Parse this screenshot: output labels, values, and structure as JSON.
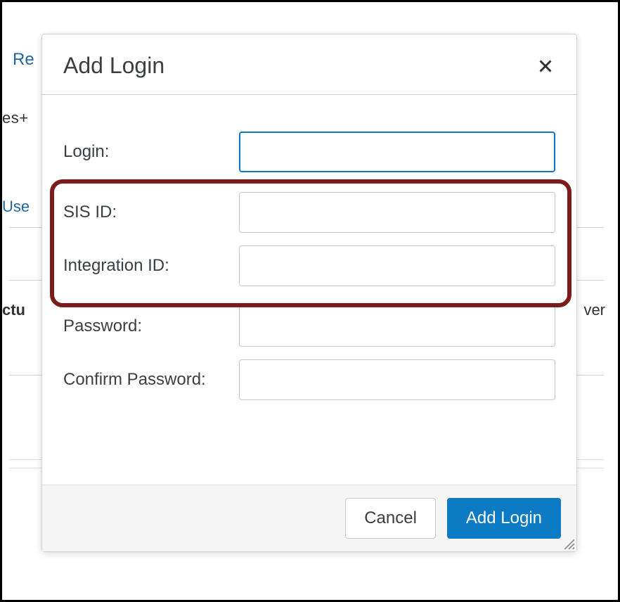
{
  "background": {
    "topLink": "Re",
    "secondLine": "es+",
    "userLink": "Use",
    "leftBold": "ctu",
    "rightText": "ver"
  },
  "modal": {
    "title": "Add Login",
    "fields": {
      "login": {
        "label": "Login:",
        "value": ""
      },
      "sisId": {
        "label": "SIS ID:",
        "value": ""
      },
      "integrationId": {
        "label": "Integration ID:",
        "value": ""
      },
      "password": {
        "label": "Password:",
        "value": ""
      },
      "confirmPassword": {
        "label": "Confirm Password:",
        "value": ""
      }
    },
    "buttons": {
      "cancel": "Cancel",
      "submit": "Add Login"
    }
  }
}
